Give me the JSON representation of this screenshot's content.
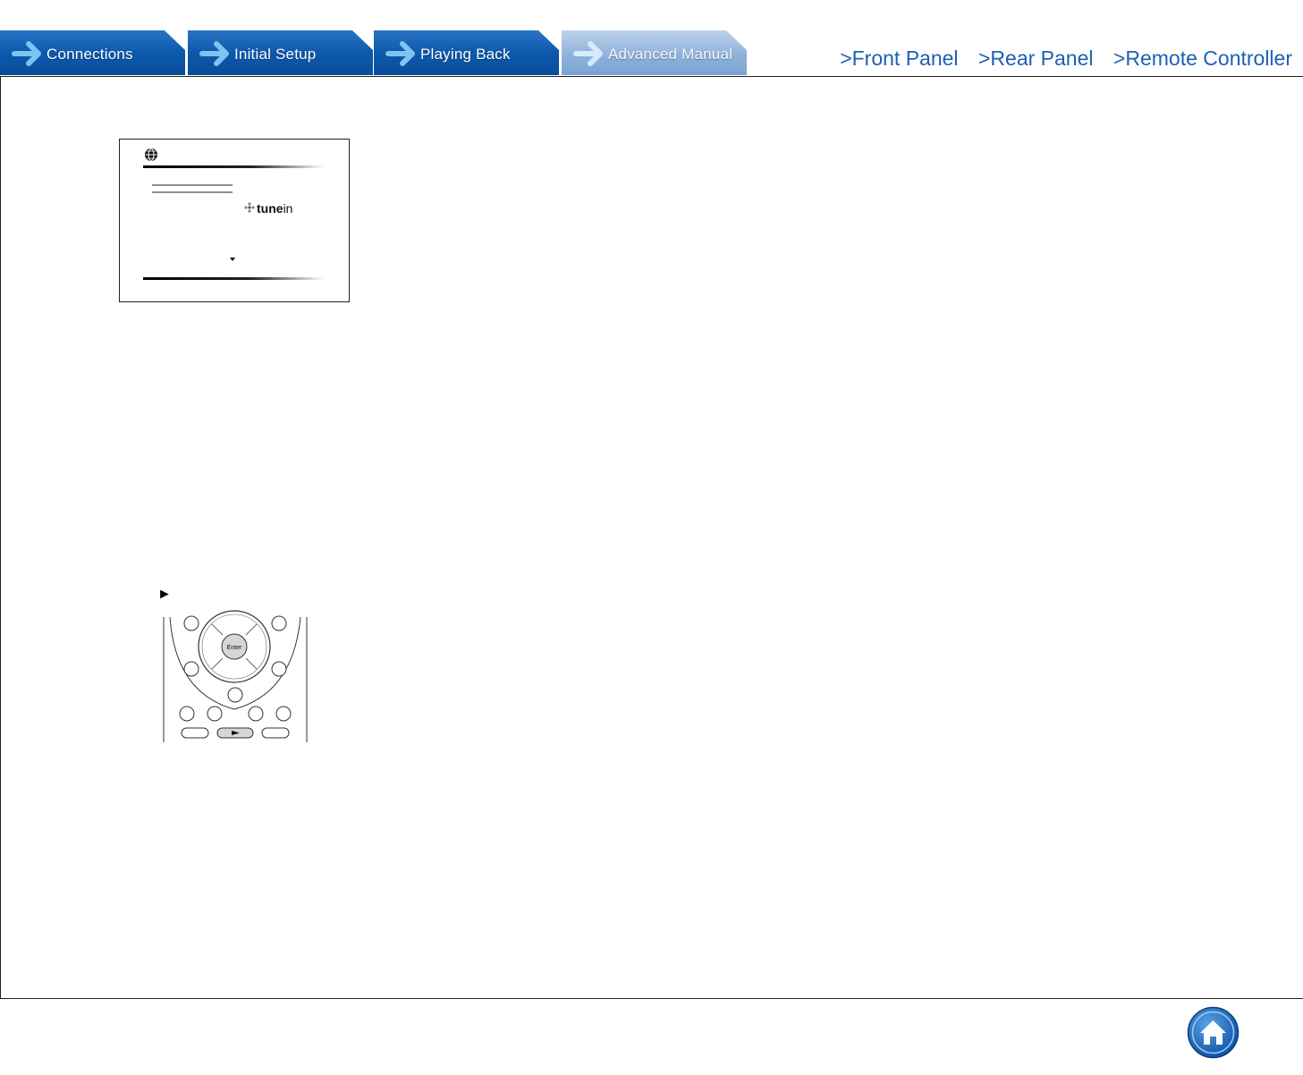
{
  "tabs": [
    {
      "label": "Connections",
      "active": false
    },
    {
      "label": "Initial Setup",
      "active": false
    },
    {
      "label": "Playing Back",
      "active": false
    },
    {
      "label": "Advanced Manual",
      "active": true
    }
  ],
  "nav_links": {
    "front_panel": ">Front Panel",
    "rear_panel": ">Rear Panel",
    "remote_controller": ">Remote Controller"
  },
  "screen": {
    "service_logo_text_bold": "tune",
    "service_logo_text_light": "in",
    "icon": "globe-icon"
  },
  "remote": {
    "enter_label": "Enter",
    "play_symbol": "►"
  },
  "play_symbol_label": "►",
  "home_icon": "home-icon",
  "colors": {
    "tab_blue": "#0d59ad",
    "tab_active": "#8fb2da",
    "link_blue": "#1f5fb5"
  }
}
